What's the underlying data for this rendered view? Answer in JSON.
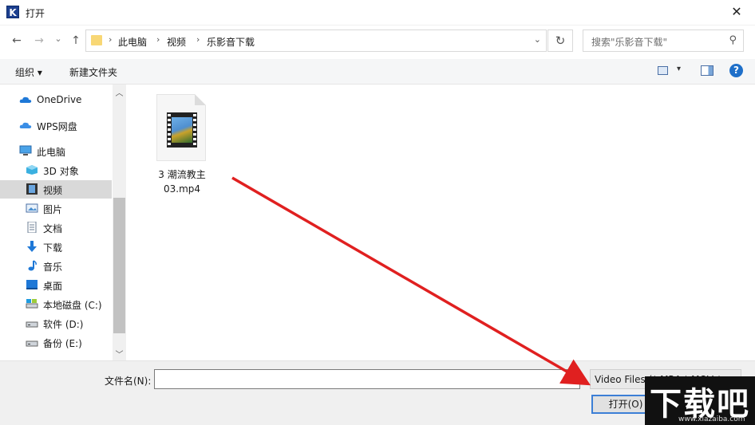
{
  "window": {
    "title": "打开",
    "app_icon_letter": "K",
    "close_glyph": "✕"
  },
  "nav": {
    "back_glyph": "←",
    "forward_glyph": "→",
    "recent_glyph": "⌄",
    "up_glyph": "↑",
    "breadcrumbs": [
      "此电脑",
      "视频",
      "乐影音下载"
    ],
    "separator": "›",
    "address_dropdown_glyph": "⌄",
    "refresh_glyph": "↻",
    "search_placeholder": "搜索\"乐影音下载\"",
    "search_glyph": "⚲"
  },
  "toolbar": {
    "organize_label": "组织 ▾",
    "new_folder_label": "新建文件夹",
    "view_dd_glyph": "▾",
    "help_glyph": "?"
  },
  "sidebar": {
    "items": [
      {
        "label": "OneDrive",
        "icon": "cloud-icon",
        "selected": false
      },
      {
        "label": "WPS网盘",
        "icon": "wps-cloud-icon",
        "selected": false
      },
      {
        "label": "此电脑",
        "icon": "computer-icon",
        "selected": false
      },
      {
        "label": "3D 对象",
        "icon": "cube-icon",
        "selected": false
      },
      {
        "label": "视频",
        "icon": "video-icon",
        "selected": true
      },
      {
        "label": "图片",
        "icon": "picture-icon",
        "selected": false
      },
      {
        "label": "文档",
        "icon": "document-icon",
        "selected": false
      },
      {
        "label": "下载",
        "icon": "download-icon",
        "selected": false
      },
      {
        "label": "音乐",
        "icon": "music-icon",
        "selected": false
      },
      {
        "label": "桌面",
        "icon": "desktop-icon",
        "selected": false
      },
      {
        "label": "本地磁盘 (C:)",
        "icon": "drive-c-icon",
        "selected": false
      },
      {
        "label": "软件 (D:)",
        "icon": "drive-icon",
        "selected": false
      },
      {
        "label": "备份 (E:)",
        "icon": "drive-icon",
        "selected": false
      }
    ],
    "scroll_up_glyph": "︿",
    "scroll_down_glyph": "﹀"
  },
  "files": [
    {
      "name_line1": "3 潮流教主",
      "name_line2": "03.mp4",
      "icon": "video-file-icon"
    }
  ],
  "footer": {
    "filename_label": "文件名(N):",
    "filename_value": "",
    "filter_text": "Video Files (*.MP4;*.MOV;*.",
    "filter_dd_glyph": "⌄",
    "open_label": "打开(O)"
  },
  "watermark": {
    "big": "下载吧",
    "small": "www.xiazaiba.com"
  },
  "colors": {
    "accent": "#3c7fd6",
    "arrow": "#e02020",
    "selected_bg": "#d9d9d9"
  }
}
